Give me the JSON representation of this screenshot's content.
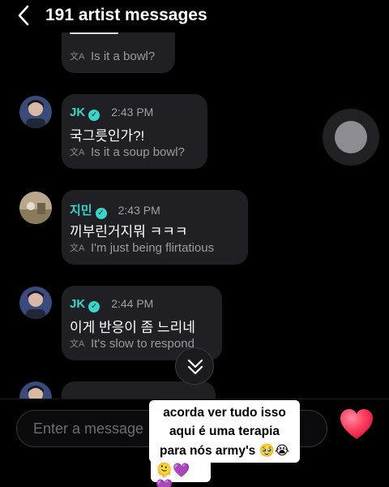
{
  "header": {
    "title": "191 artist messages"
  },
  "messages": [
    {
      "translation": "Is it a bowl?"
    },
    {
      "name": "JK",
      "time": "2:43 PM",
      "text": "국그릇인가?!",
      "translation": "Is it a soup bowl?"
    },
    {
      "name": "지민",
      "time": "2:43 PM",
      "text": "끼부린거지뭐 ㅋㅋㅋ",
      "translation": "I'm just being flirtatious"
    },
    {
      "name": "JK",
      "time": "2:44 PM",
      "text": "이게 반응이 좀 느리네",
      "translation": "It's slow to respond"
    }
  ],
  "composer": {
    "placeholder": "Enter a message"
  },
  "overlay": {
    "lines": [
      "acorda ver tudo isso",
      "aqui é uma terapia",
      "para nós army's"
    ],
    "emoji_after_line3": "🥹😭",
    "emoji_row": "🫠💜💜"
  },
  "colors": {
    "accent": "#36d6c8",
    "bubble": "#202024",
    "heart": "#ff3b5c"
  },
  "icons": [
    "back-chevron-icon",
    "translate-icon",
    "verified-badge-icon",
    "chevron-double-down-icon",
    "heart-icon"
  ]
}
